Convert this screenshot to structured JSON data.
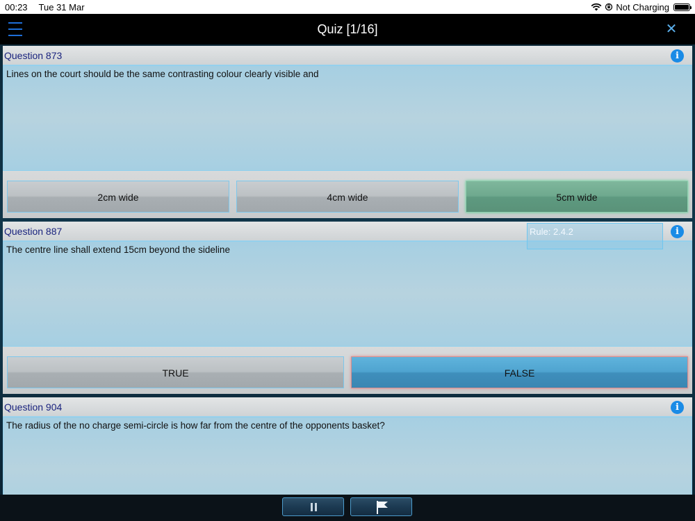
{
  "status_bar": {
    "time": "00:23",
    "date": "Tue 31 Mar",
    "charging": "Not Charging",
    "icons": [
      "wifi-icon",
      "orientation-lock-icon",
      "battery-icon"
    ]
  },
  "nav": {
    "title": "Quiz [1/16]",
    "menu_icon": "hamburger-menu-icon",
    "close_icon": "close-icon",
    "close_glyph": "✕"
  },
  "questions": [
    {
      "header": "Question 873",
      "text": "Lines on the court should be the same contrasting colour clearly visible and",
      "answers": [
        {
          "label": "2cm wide",
          "state": "default"
        },
        {
          "label": "4cm wide",
          "state": "default"
        },
        {
          "label": "5cm wide",
          "state": "correct"
        }
      ]
    },
    {
      "header": "Question 887",
      "text": "The centre line shall extend 15cm beyond the sideline",
      "rule": "Rule: 2.4.2",
      "answers": [
        {
          "label": "TRUE",
          "state": "default"
        },
        {
          "label": "FALSE",
          "state": "selected"
        }
      ]
    },
    {
      "header": "Question 904",
      "text": "The radius of the no charge semi-circle is how far from the centre of the opponents basket?"
    }
  ],
  "info_glyph": "i",
  "toolbar": {
    "icons": [
      "pause-icon",
      "flag-icon"
    ]
  },
  "colors": {
    "accent_blue": "#1a8be6",
    "question_header_text": "#1a237e",
    "correct_green": "#6ea98e",
    "selected_blue": "#4fa4d0"
  }
}
